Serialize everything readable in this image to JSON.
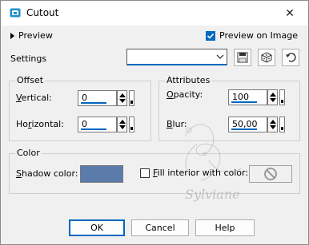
{
  "window": {
    "title": "Cutout",
    "close_glyph": "✕"
  },
  "preview": {
    "toggle_label": "Preview",
    "preview_on_image_label": "Preview on Image",
    "preview_on_image_checked": true
  },
  "settings": {
    "label": "Settings",
    "preset_value": ""
  },
  "offset": {
    "title": "Offset",
    "vertical": {
      "label_first": "V",
      "label_rest": "ertical:",
      "value": "0"
    },
    "horizontal": {
      "label_first": "Ho",
      "label_u": "r",
      "label_rest": "izontal:",
      "value": "0"
    }
  },
  "attributes": {
    "title": "Attributes",
    "opacity": {
      "label_first": "O",
      "label_rest": "pacity:",
      "value": "100"
    },
    "blur": {
      "label_first": "B",
      "label_u": "l",
      "label_rest": "ur:",
      "value": "50,00"
    }
  },
  "color": {
    "title": "Color",
    "shadow_label_first": "S",
    "shadow_label_rest": "hadow color:",
    "shadow_color": "#5b7cab",
    "fill_interior_label_first": "F",
    "fill_interior_label_rest": "ill interior with color:",
    "fill_interior_checked": false
  },
  "buttons": {
    "ok": "OK",
    "cancel": "Cancel",
    "help": "Help"
  },
  "watermark": {
    "text": "Sylviane"
  },
  "icons": {
    "app": "cutout-app-icon",
    "save": "save-preset-icon",
    "randomize": "randomize-dice-icon",
    "reset": "reset-icon",
    "none": "none-icon"
  },
  "accent_color": "#0067c0"
}
